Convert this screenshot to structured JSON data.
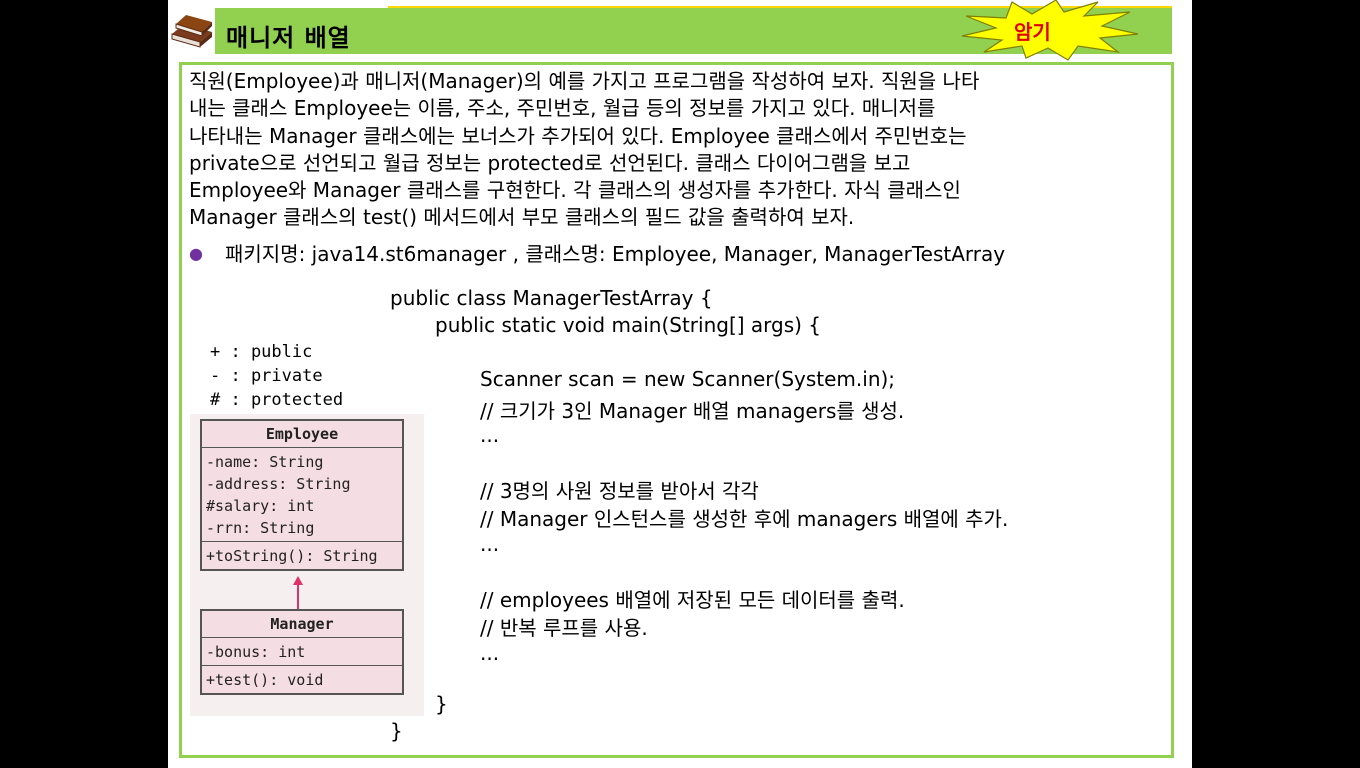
{
  "header": {
    "title": "매니저 배열",
    "badge": "암기"
  },
  "paragraph": [
    "직원(Employee)과 매니저(Manager)의 예를 가지고 프로그램을 작성하여 보자. 직원을 나타",
    "내는 클래스 Employee는 이름, 주소, 주민번호, 월급 등의 정보를 가지고 있다. 매니저를",
    "나타내는 Manager 클래스에는 보너스가 추가되어 있다. Employee 클래스에서 주민번호는",
    "private으로 선언되고 월급 정보는 protected로 선언된다. 클래스 다이어그램을 보고",
    "Employee와 Manager 클래스를 구현한다. 각 클래스의 생성자를 추가한다. 자식 클래스인",
    "Manager 클래스의 test() 메서드에서 부모 클래스의 필드 값을 출력하여 보자."
  ],
  "bullet": "패키지명: java14.st6manager ,  클래스명: Employee, Manager, ManagerTestArray",
  "legend": [
    "+ : public",
    "- : private",
    "# : protected"
  ],
  "uml": {
    "employee": {
      "name": "Employee",
      "fields": [
        "-name: String",
        "-address: String",
        "#salary: int",
        "-rrn: String"
      ],
      "methods": [
        "+toString(): String"
      ]
    },
    "manager": {
      "name": "Manager",
      "fields": [
        "-bonus: int"
      ],
      "methods": [
        "+test(): void"
      ]
    }
  },
  "code": {
    "l1": "public class ManagerTestArray {",
    "l2": "public static void main(String[] args) {",
    "l3": "Scanner scan = new Scanner(System.in);",
    "l4": "// 크기가 3인 Manager 배열 managers를 생성.",
    "l5": "...",
    "l6": "// 3명의 사원 정보를 받아서 각각",
    "l7": "// Manager 인스턴스를 생성한 후에 managers 배열에 추가.",
    "l8": "...",
    "l9": "// employees 배열에 저장된 모든 데이터를 출력.",
    "l10": "// 반복 루프를 사용.",
    "l11": "...",
    "l12": "}",
    "l13": "}"
  }
}
